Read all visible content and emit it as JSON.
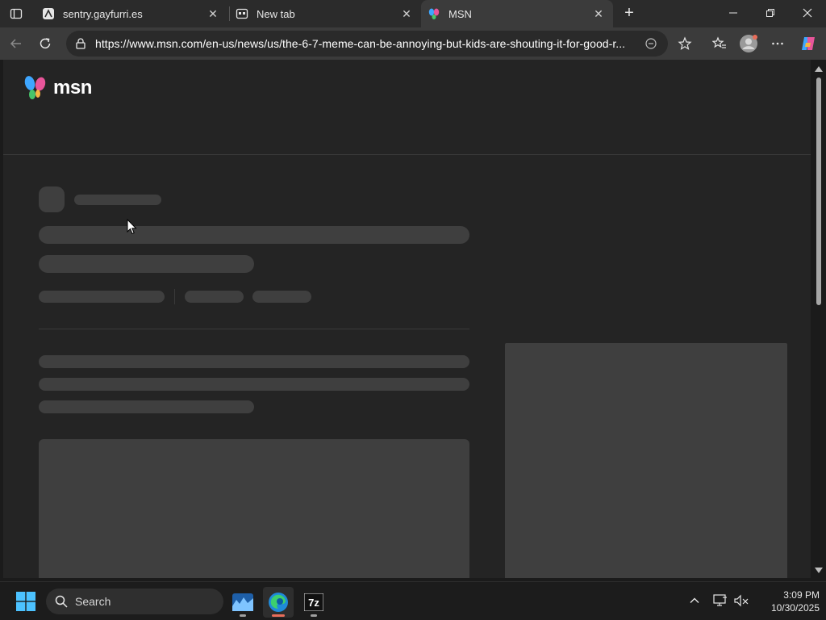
{
  "browser": {
    "tabs": [
      {
        "title": "sentry.gayfurri.es",
        "favicon": "sentry-icon",
        "active": false
      },
      {
        "title": "New tab",
        "favicon": "newtab-icon",
        "active": false
      },
      {
        "title": "MSN",
        "favicon": "msn-icon",
        "active": true
      }
    ],
    "tab_close_glyph": "✕",
    "new_tab_glyph": "+",
    "address": {
      "url": "https://www.msn.com/en-us/news/us/the-6-7-meme-can-be-annoying-but-kids-are-shouting-it-for-good-r..."
    }
  },
  "page": {
    "logo_text": "msn",
    "state": "loading-skeleton"
  },
  "taskbar": {
    "search_placeholder": "Search",
    "apps": [
      "weather-app-icon",
      "edge-icon",
      "7zip-icon"
    ],
    "seven_zip_label": "7z",
    "time": "3:09 PM",
    "date": "10/30/2025"
  },
  "colors": {
    "accent_edge": "#e86d5a",
    "skeleton": "#3f3f3f",
    "page_bg": "#242424"
  }
}
